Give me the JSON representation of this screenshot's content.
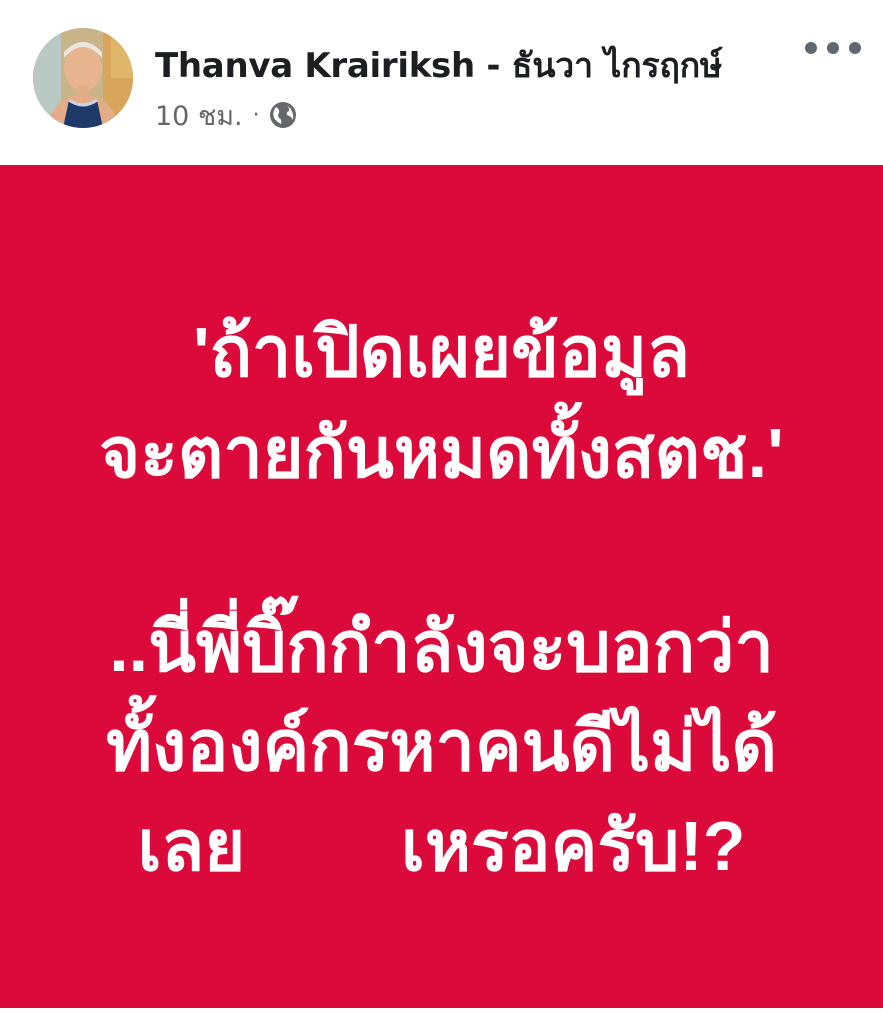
{
  "post": {
    "author": "Thanva Krairiksh - ธันวา ไกรฤกษ์",
    "time": "10 ชม.",
    "separator": "·",
    "privacy_icon": "globe-icon",
    "more_icon": "more-options-icon"
  },
  "card": {
    "background": "#dc0a3a",
    "text_color": "#ffffff",
    "lines": [
      "'ถ้าเปิดเผยข้อมูล",
      "จะตายกันหมดทั้งสตช.'",
      "..นี่พี่บิ๊กกำลังจะบอกว่า",
      "ทั้งองค์กรหาคนดีไม่ได้",
      "เลย        เหรอครับ!?"
    ]
  }
}
